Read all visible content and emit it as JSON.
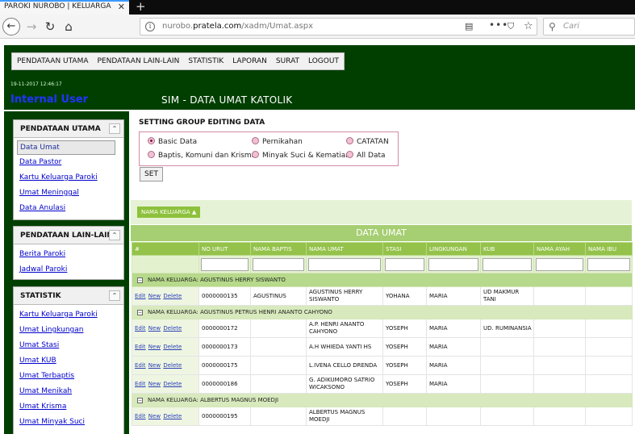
{
  "browser": {
    "tab_title": "PAROKI NUROBO | KELUARGA KATOLIK",
    "tab_close": "✕",
    "new_tab": "+",
    "url_prefix": "nurobo.",
    "url_domain": "pratela.com",
    "url_path": "/xadm/Umat.aspx",
    "search_placeholder": "Cari"
  },
  "header": {
    "menu": [
      "PENDATAAN UTAMA",
      "PENDATAAN LAIN-LAIN",
      "STATISTIK",
      "LAPORAN",
      "SURAT",
      "LOGOUT"
    ],
    "datetime": "19-11-2017 12:46:17",
    "user": "Internal User",
    "page_title": "SIM - DATA UMAT KATOLIK"
  },
  "sidebar": {
    "panels": [
      {
        "title": "PENDATAAN UTAMA",
        "items": [
          "Data Umat",
          "Data Pastor",
          "Kartu Keluarga Paroki",
          "Umat Meninggal",
          "Data Anulasi"
        ]
      },
      {
        "title": "PENDATAAN LAIN-LAIN",
        "items": [
          "Berita Paroki",
          "Jadwal Paroki"
        ]
      },
      {
        "title": "STATISTIK",
        "items": [
          "Kartu Keluarga Paroki",
          "Umat Lingkungan",
          "Umat Stasi",
          "Umat KUB",
          "Umat Terbaptis",
          "Umat Menikah",
          "Umat Krisma",
          "Umat Minyak Suci"
        ]
      }
    ]
  },
  "setting": {
    "title": "SETTING GROUP EDITING DATA",
    "options": [
      "Basic Data",
      "Pernikahan",
      "CATATAN",
      "Baptis, Komuni dan Krisma",
      "Minyak Suci & Kematian",
      "All Data"
    ],
    "selected": "Basic Data",
    "set_label": "SET"
  },
  "grid": {
    "group_button": "NAMA KELUARGA ▲",
    "title": "DATA UMAT",
    "columns": [
      "#",
      "NO URUT",
      "NAMA BAPTIS",
      "NAMA UMAT",
      "STASI",
      "LINGKUNGAN",
      "KUB",
      "NAMA AYAH",
      "NAMA IBU"
    ],
    "actions": {
      "edit": "Edit",
      "new": "New",
      "delete": "Delete"
    },
    "expander": "−",
    "groups": [
      {
        "label": "NAMA KELUARGA: AGUSTINUS HERRY SISWANTO",
        "rows": [
          [
            "0000000135",
            "AGUSTINUS",
            "AGUSTINUS HERRY SISWANTO",
            "YOHANA",
            "MARIA",
            "UD MAKMUR TANI",
            "",
            ""
          ]
        ]
      },
      {
        "label": "NAMA KELUARGA: AGUSTINUS PETRUS HENRI ANANTO CAHYONO",
        "rows": [
          [
            "0000000172",
            "",
            "A.P. HENRI ANANTO CAHYONO",
            "YOSEPH",
            "MARIA",
            "UD. RUMINANSIA",
            "",
            ""
          ],
          [
            "0000000173",
            "",
            "A.H WHIEDA YANTI HS",
            "YOSEPH",
            "MARIA",
            "",
            "",
            ""
          ],
          [
            "0000000175",
            "",
            "L.IVENA CELLO DRENDA",
            "YOSEPH",
            "MARIA",
            "",
            "",
            ""
          ],
          [
            "0000000186",
            "",
            "G. ADIKUMORO SATRIO WICAKSONO",
            "YOSEPH",
            "MARIA",
            "",
            "",
            ""
          ]
        ]
      },
      {
        "label": "NAMA KELUARGA: ALBERTUS MAGNUS MOEDJI",
        "rows": [
          [
            "0000000195",
            "",
            "ALBERTUS MAGNUS MOEDJI",
            "",
            "",
            "",
            "",
            ""
          ]
        ]
      }
    ]
  }
}
